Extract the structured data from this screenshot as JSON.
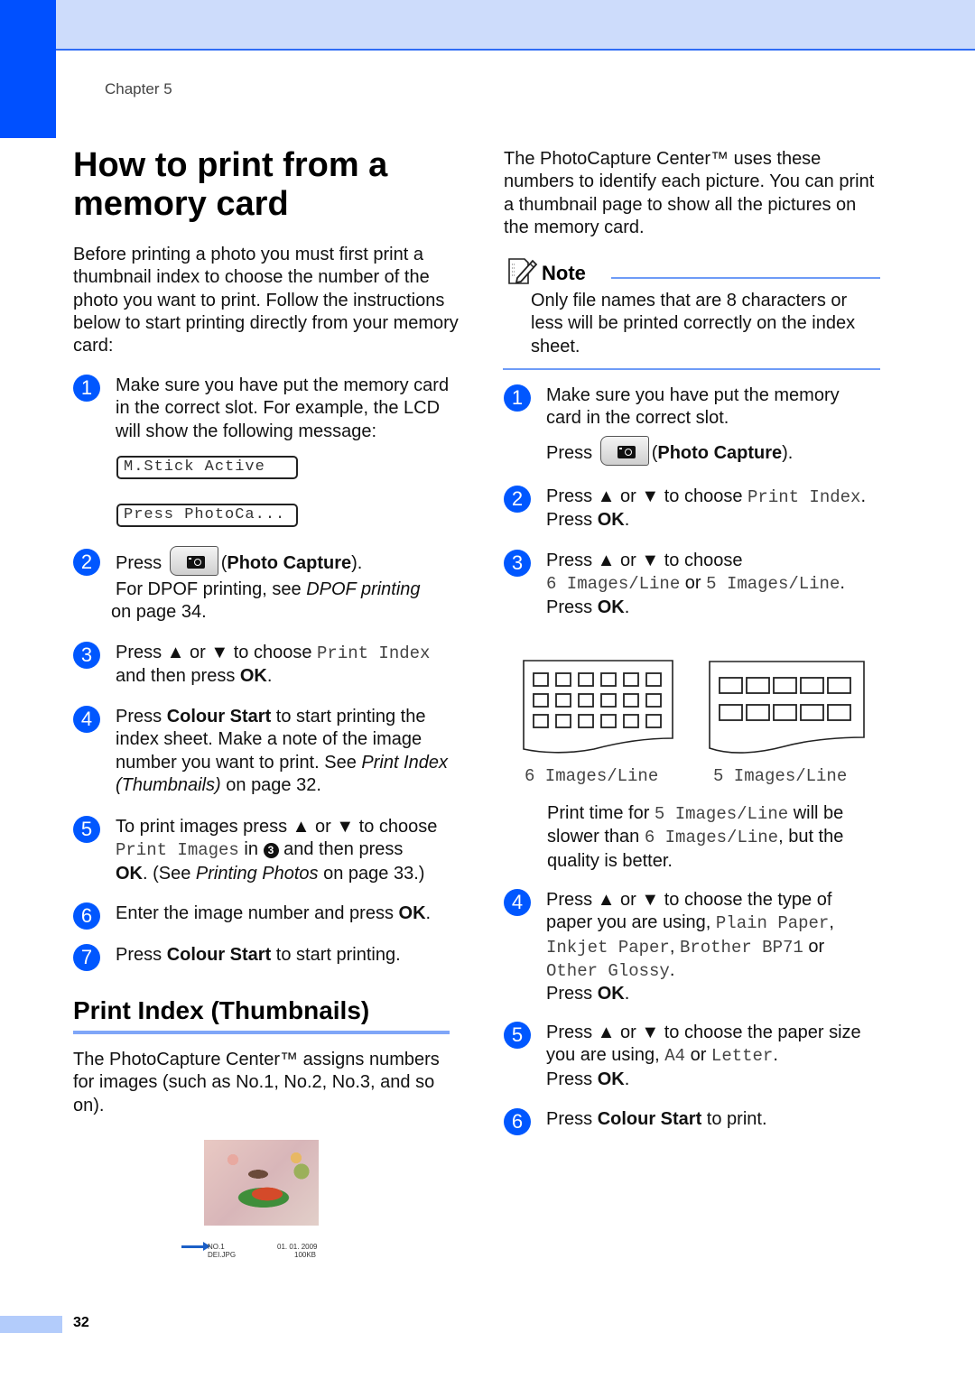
{
  "header": {
    "chapter": "Chapter 5"
  },
  "left": {
    "title": "How to print from a memory card",
    "intro": "Before printing a photo you must first print a thumbnail index to choose the number of the photo you want to print. Follow the instructions below to start printing directly from your memory card:",
    "steps": [
      {
        "num": "1",
        "text": "Make sure you have put the memory card in the correct slot. For example, the LCD will show the following message:"
      },
      {
        "num": "2",
        "press": "Press",
        "button_name": "Photo Capture",
        "after": ").",
        "line2_pre": "For DPOF printing, see ",
        "line2_link": "DPOF printing",
        "line2_post": " on page 34."
      },
      {
        "num": "3",
        "pre": "Press ▲ or ▼ to choose ",
        "mono": "Print Index",
        "post1": "and then press ",
        "bold": "OK",
        "post2": "."
      },
      {
        "num": "4",
        "pre": "Press ",
        "bold": "Colour Start",
        "mid": " to start printing the index sheet. Make a note of the image number you want to print. See ",
        "link": "Print Index (Thumbnails)",
        "post": " on page 32."
      },
      {
        "num": "5",
        "pre": "To print images press ▲ or ▼ to choose",
        "mono": "Print Images",
        "mid": " in ",
        "ref": "3",
        "mid2": " and then press",
        "bold": "OK",
        "post1": ". (See ",
        "link": "Printing Photos",
        "post2": " on page 33.)"
      },
      {
        "num": "6",
        "pre": "Enter the image number and press ",
        "bold": "OK",
        "post": "."
      },
      {
        "num": "7",
        "pre": "Press ",
        "bold": "Colour Start",
        "post": " to start printing."
      }
    ],
    "lcd_messages": [
      "M.Stick Active",
      "Press PhotoCa..."
    ],
    "section_title": "Print Index (Thumbnails)",
    "section_text": "The PhotoCapture Center™ assigns numbers for images (such as No.1, No.2, No.3, and so on).",
    "thumb_caption": {
      "number": "NO.1",
      "filename": "DEI.JPG",
      "date": "01. 01. 2009",
      "size": "100KB"
    }
  },
  "right": {
    "intro": "The PhotoCapture Center™ uses these numbers to identify each picture. You can print a thumbnail page to show all the pictures on the memory card.",
    "note": {
      "title": "Note",
      "text": "Only file names that are 8 characters or less will be printed correctly on the index sheet."
    },
    "steps": [
      {
        "num": "1",
        "text": "Make sure you have put the memory card in the correct slot.",
        "press": "Press",
        "button_name": "Photo Capture",
        "after": ")."
      },
      {
        "num": "2",
        "pre": "Press ▲ or ▼ to choose ",
        "mono": "Print Index",
        "post": ".",
        "line2_pre": "Press ",
        "line2_bold": "OK",
        "line2_post": "."
      },
      {
        "num": "3",
        "pre": "Press ▲ or ▼ to choose",
        "mono1": "6 Images/Line",
        "or": " or ",
        "mono2": "5 Images/Line",
        "post": ".",
        "line3_pre": "Press ",
        "line3_bold": "OK",
        "line3_post": "."
      },
      {
        "num": "4",
        "pre": "Press ▲ or ▼ to choose the type of paper you are using, ",
        "mono1": "Plain Paper",
        "comma": ",",
        "mono2": "Inkjet Paper",
        "comma2": ", ",
        "mono3": "Brother BP71",
        "or": " or",
        "mono4": "Other Glossy",
        "post": ".",
        "press_pre": "Press ",
        "press_bold": "OK",
        "press_post": "."
      },
      {
        "num": "5",
        "pre": "Press ▲ or ▼ to choose the paper size you are using, ",
        "mono1": "A4",
        "or": " or ",
        "mono2": "Letter",
        "post": ".",
        "press_pre": "Press ",
        "press_bold": "OK",
        "press_post": "."
      },
      {
        "num": "6",
        "pre": "Press ",
        "bold": "Colour Start",
        "post": " to print."
      }
    ],
    "layouts": [
      {
        "label": "6 Images/Line",
        "columns": 6,
        "rows": 3
      },
      {
        "label": "5 Images/Line",
        "columns": 5,
        "rows": 2
      }
    ],
    "print_time": {
      "pre": "Print time for ",
      "mono1": "5 Images/Line",
      "mid": " will be slower than ",
      "mono2": "6 Images/Line",
      "post": ", but the quality is better."
    }
  },
  "footer": {
    "page_number": "32"
  },
  "colors": {
    "accent": "#0050ff",
    "band": "#cddcfb",
    "rule": "#7fa6f8",
    "step_badge": "#0057ff"
  }
}
